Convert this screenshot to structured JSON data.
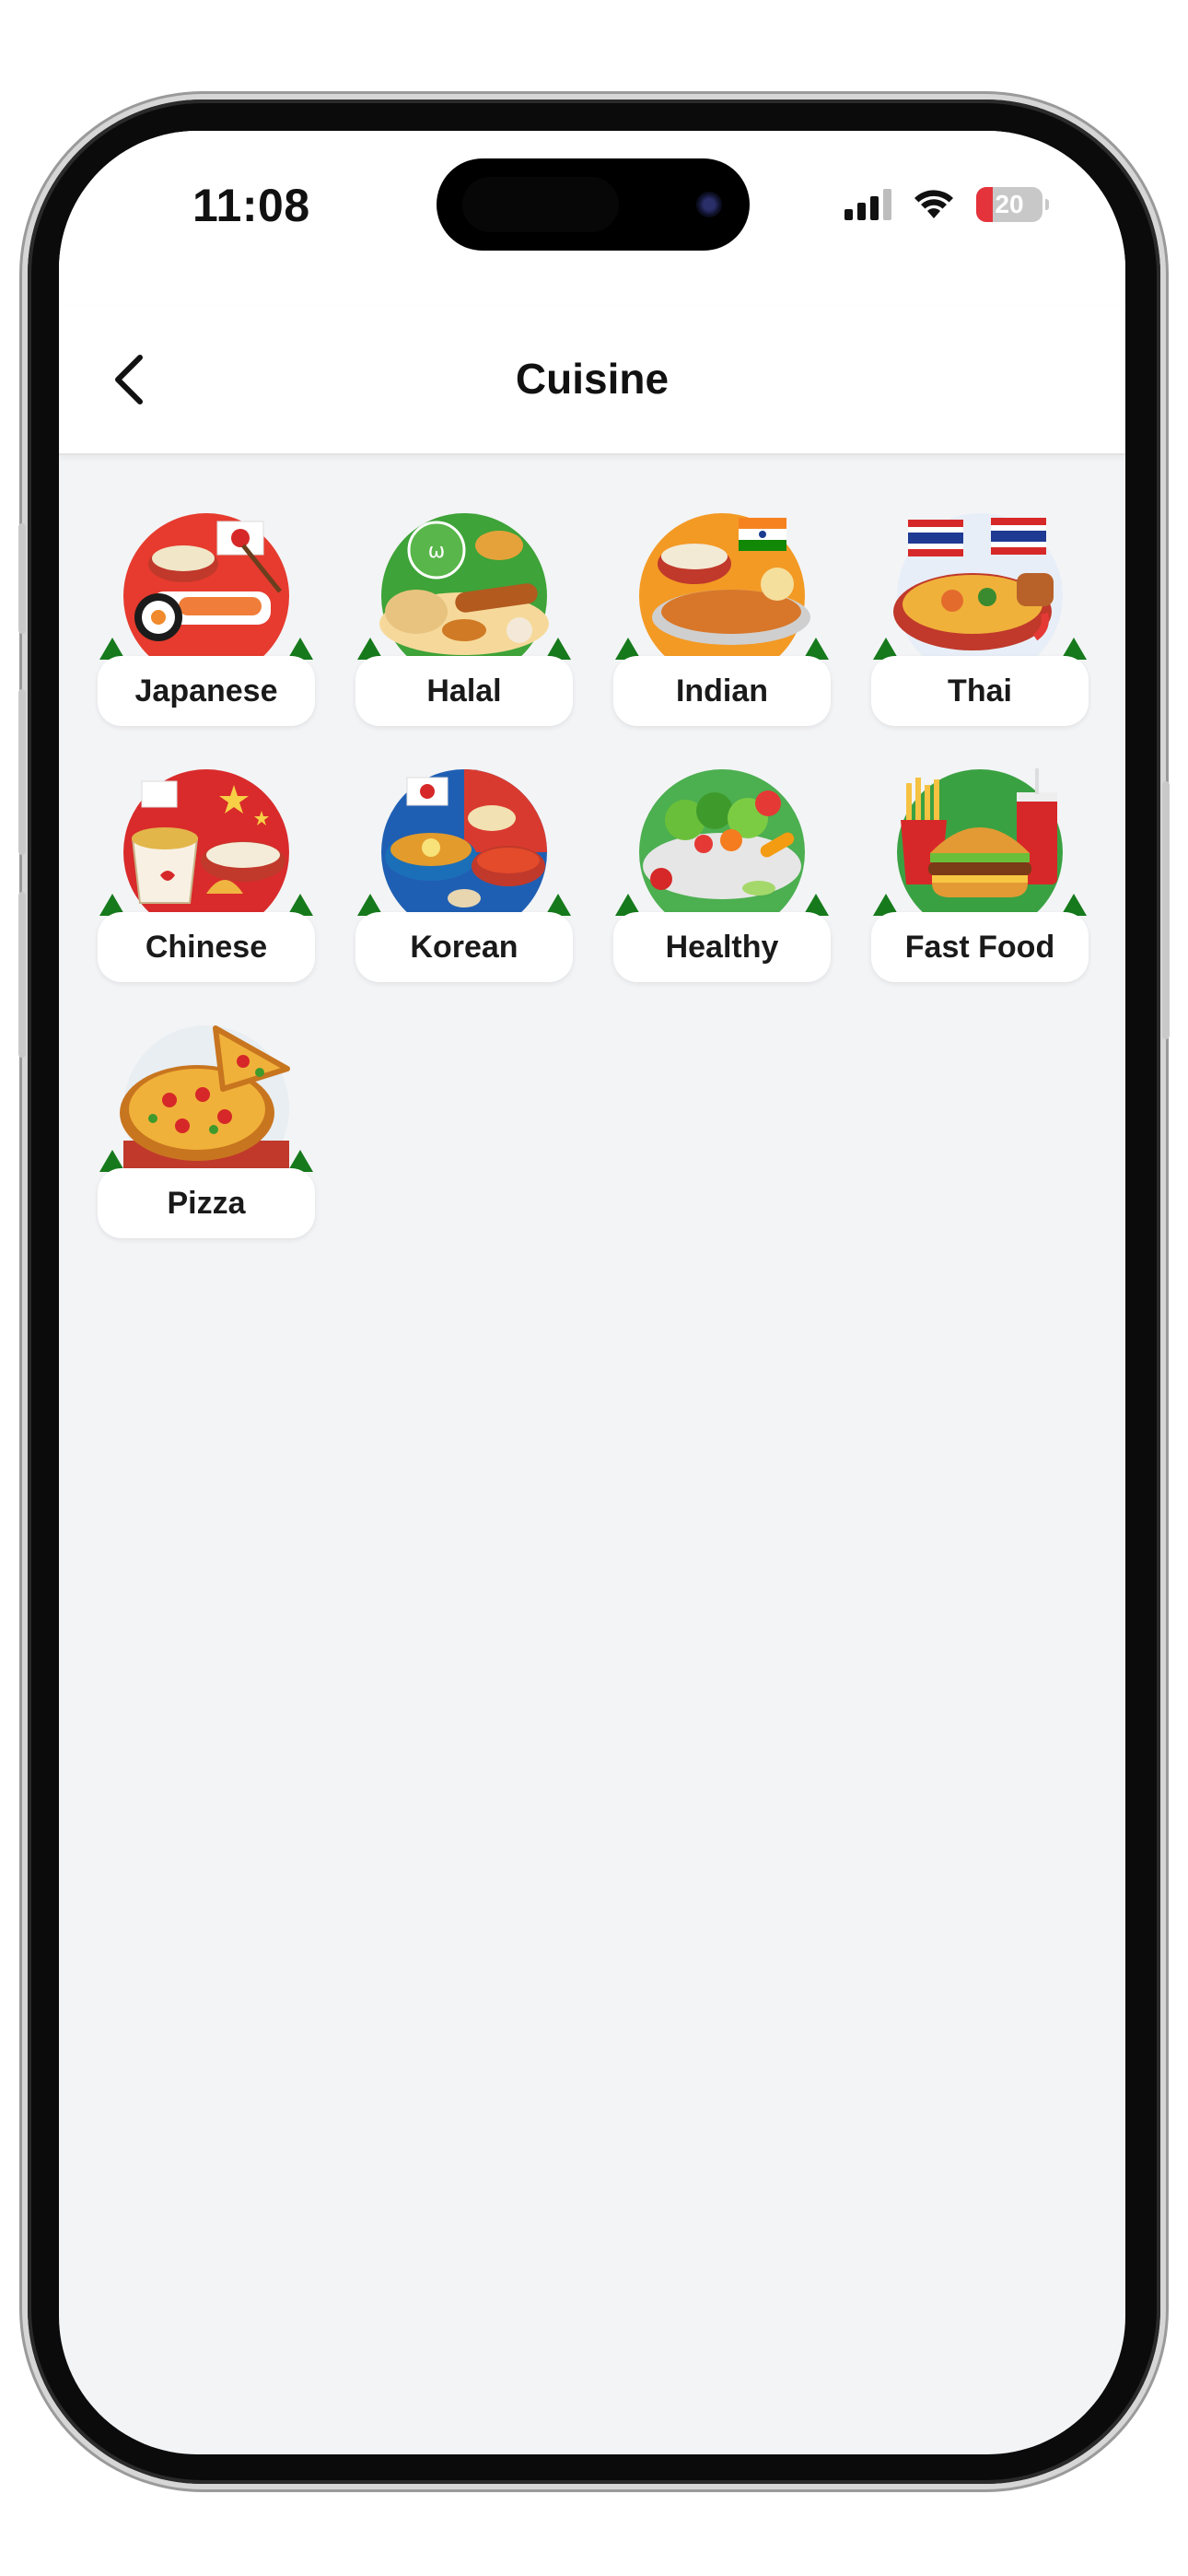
{
  "status_bar": {
    "time": "11:08",
    "battery": "20"
  },
  "header": {
    "title": "Cuisine",
    "back_icon": "chevron-left-icon"
  },
  "cuisines": [
    {
      "label": "Japanese",
      "icon": "japanese-food-icon"
    },
    {
      "label": "Halal",
      "icon": "halal-food-icon"
    },
    {
      "label": "Indian",
      "icon": "indian-food-icon"
    },
    {
      "label": "Thai",
      "icon": "thai-food-icon"
    },
    {
      "label": "Chinese",
      "icon": "chinese-food-icon"
    },
    {
      "label": "Korean",
      "icon": "korean-food-icon"
    },
    {
      "label": "Healthy",
      "icon": "healthy-food-icon"
    },
    {
      "label": "Fast Food",
      "icon": "fast-food-icon"
    },
    {
      "label": "Pizza",
      "icon": "pizza-icon"
    }
  ],
  "colors": {
    "background": "#f3f4f6",
    "card": "#ffffff",
    "accent_green": "#167a1c",
    "battery_low": "#e5333b"
  }
}
